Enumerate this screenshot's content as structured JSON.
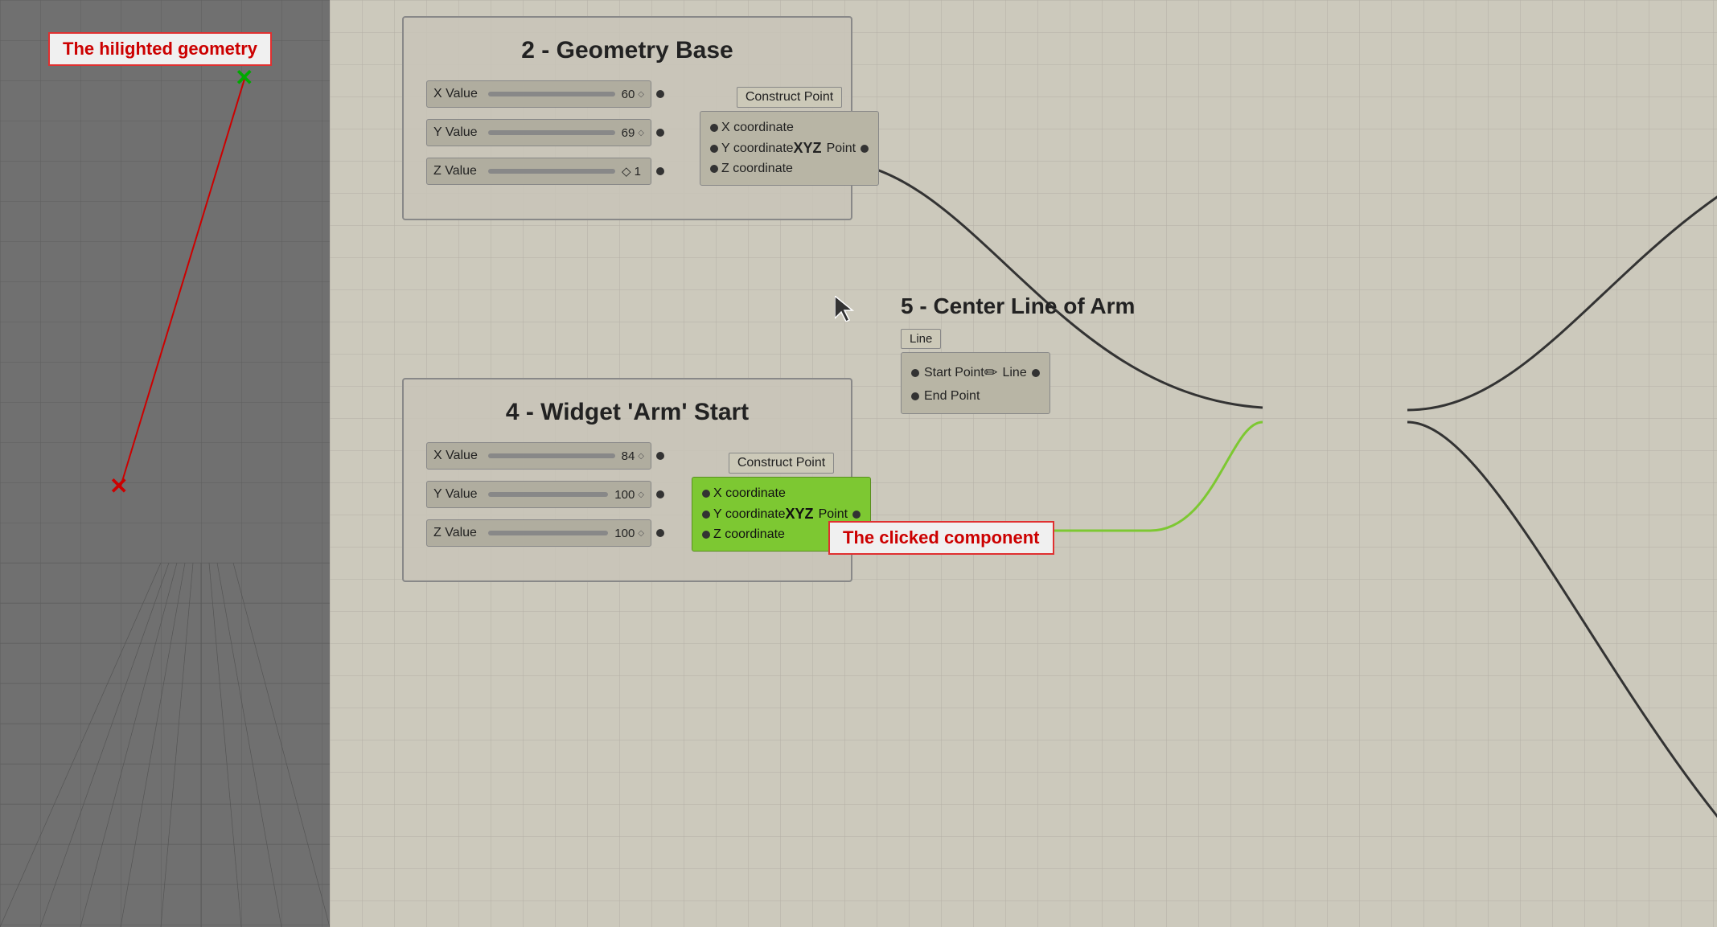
{
  "viewport": {
    "highlight_label": "The hilighted geometry"
  },
  "geometry_base": {
    "title": "2 - Geometry Base",
    "x_slider": {
      "label": "X Value",
      "value": "60",
      "diamond": "◇"
    },
    "y_slider": {
      "label": "Y Value",
      "value": "69",
      "diamond": "◇"
    },
    "z_slider": {
      "label": "Z Value",
      "value": "◇ 1"
    },
    "construct_point_label": "Construct Point",
    "x_coord": "X coordinate",
    "y_coord": "Y coordinate",
    "z_coord": "Z coordinate",
    "point_label": "Point"
  },
  "widget_arm": {
    "title": "4 - Widget 'Arm' Start",
    "x_slider": {
      "label": "X Value",
      "value": "84",
      "diamond": "◇"
    },
    "y_slider": {
      "label": "Y Value",
      "value": "100",
      "diamond": "◇"
    },
    "z_slider": {
      "label": "Z Value",
      "value": "100",
      "diamond": "◇"
    },
    "construct_point_label": "Construct Point",
    "x_coord": "X coordinate",
    "y_coord": "Y coordinate",
    "z_coord": "Z coordinate",
    "point_label": "Point"
  },
  "center_line": {
    "title": "5 - Center Line of Arm",
    "line_label": "Line",
    "start_point": "Start Point",
    "end_point": "End Point",
    "line_output": "Line"
  },
  "annotations": {
    "clicked_component": "The clicked component"
  },
  "colors": {
    "accent_red": "#cc0000",
    "accent_green": "#7dc832",
    "node_bg": "#b8b5a5",
    "node_bg_green": "#7dc832",
    "border": "#888888"
  }
}
